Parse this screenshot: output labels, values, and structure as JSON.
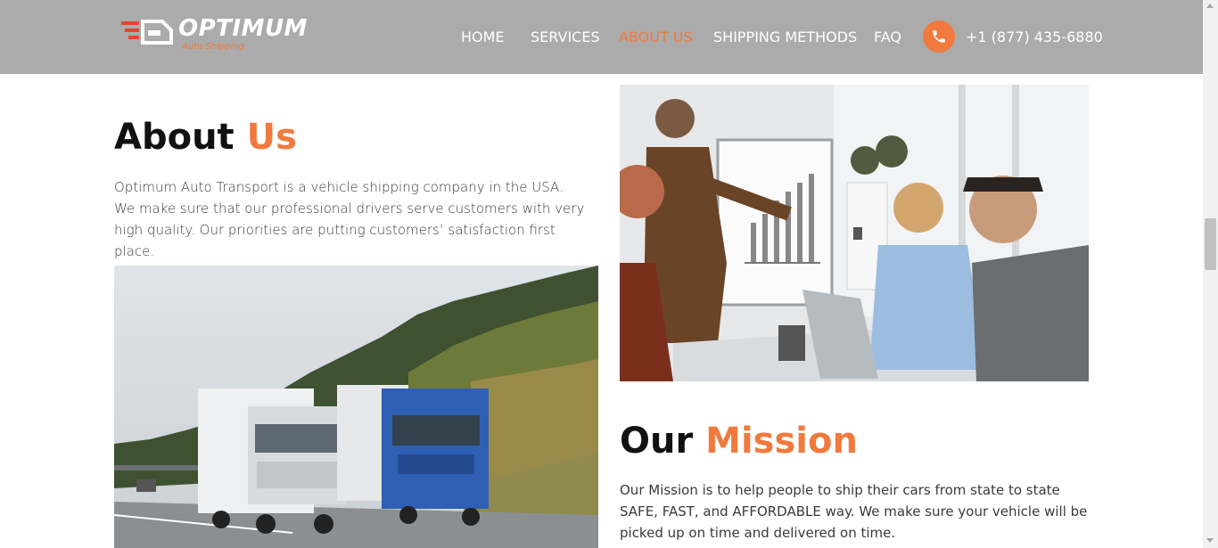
{
  "header": {
    "logo_text": "OPTIMUM",
    "logo_sub": "Auto Shipping",
    "nav": [
      {
        "label": "HOME",
        "active": false
      },
      {
        "label": "SERVICES",
        "active": false
      },
      {
        "label": "ABOUT US",
        "active": true
      },
      {
        "label": "SHIPPING METHODS",
        "active": false
      },
      {
        "label": "FAQ",
        "active": false
      }
    ],
    "phone_icon": "phone-icon",
    "phone": "+1 (877) 435-6880"
  },
  "about": {
    "heading_main": "About",
    "heading_accent": "Us",
    "text": "Optimum Auto Transport is a vehicle shipping company in the USA. We make sure that our professional drivers serve customers with very high quality. Our priorities are putting customers’ satisfaction first place."
  },
  "mission": {
    "heading_main": "Our",
    "heading_accent": "Mission",
    "text": "Our Mission is to help people to ship their cars from state to state SAFE, FAST, and AFFORDABLE way. We make sure your vehicle will be picked up on time and delivered on time."
  },
  "colors": {
    "accent": "#f07a3e",
    "header_bg": "#ababab"
  }
}
